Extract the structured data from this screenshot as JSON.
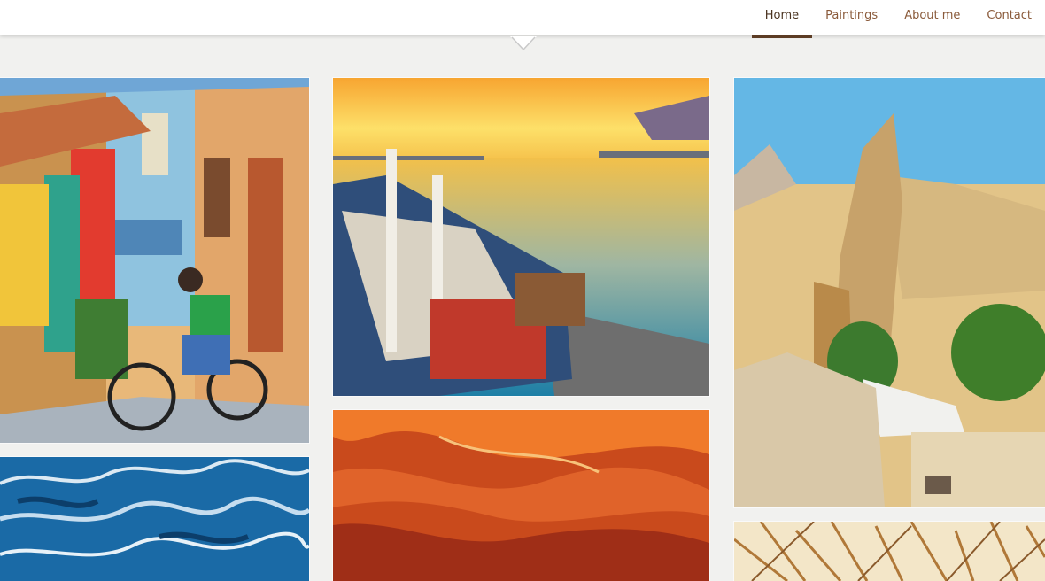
{
  "nav": {
    "items": [
      {
        "label": "Home",
        "active": true
      },
      {
        "label": "Paintings",
        "active": false
      },
      {
        "label": "About me",
        "active": false
      },
      {
        "label": "Contact",
        "active": false
      }
    ],
    "active_color": "#5c3c24",
    "link_color": "#8a5a3a"
  },
  "scroll_indicator": {
    "icon": "chevron-down-icon"
  },
  "gallery": {
    "paintings": [
      {
        "subject": "boy on bicycle, colorful street"
      },
      {
        "subject": "boat at sunset by the sea"
      },
      {
        "subject": "rock formations and cave houses"
      },
      {
        "subject": "blue water ripples"
      },
      {
        "subject": "red sandstone canyon waves"
      },
      {
        "subject": "dry golden grass"
      }
    ]
  }
}
